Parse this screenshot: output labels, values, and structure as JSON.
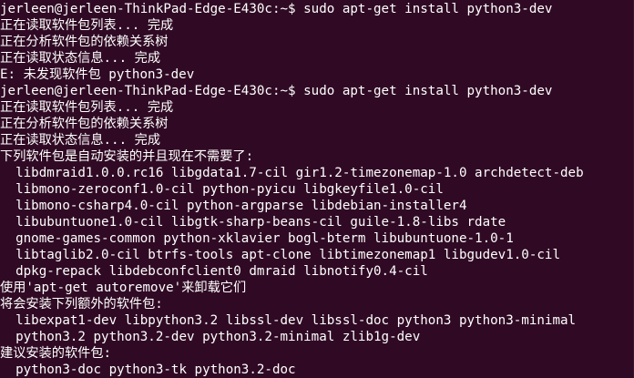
{
  "terminal": {
    "lines": [
      "jerleen@jerleen-ThinkPad-Edge-E430c:~$ sudo apt-get install python3-dev",
      "正在读取软件包列表... 完成",
      "正在分析软件包的依赖关系树",
      "正在读取状态信息... 完成",
      "E: 未发现软件包 python3-dev",
      "jerleen@jerleen-ThinkPad-Edge-E430c:~$ sudo apt-get install python3-dev",
      "正在读取软件包列表... 完成",
      "正在分析软件包的依赖关系树",
      "正在读取状态信息... 完成",
      "下列软件包是自动安装的并且现在不需要了:",
      "  libdmraid1.0.0.rc16 libgdata1.7-cil gir1.2-timezonemap-1.0 archdetect-deb",
      "  libmono-zeroconf1.0-cil python-pyicu libgkeyfile1.0-cil",
      "  libmono-csharp4.0-cil python-argparse libdebian-installer4",
      "  libubuntuone1.0-cil libgtk-sharp-beans-cil guile-1.8-libs rdate",
      "  gnome-games-common python-xklavier bogl-bterm libubuntuone-1.0-1",
      "  libtaglib2.0-cil btrfs-tools apt-clone libtimezonemap1 libgudev1.0-cil",
      "  dpkg-repack libdebconfclient0 dmraid libnotify0.4-cil",
      "使用'apt-get autoremove'来卸载它们",
      "将会安装下列额外的软件包:",
      "  libexpat1-dev libpython3.2 libssl-dev libssl-doc python3 python3-minimal",
      "  python3.2 python3.2-dev python3.2-minimal zlib1g-dev",
      "建议安装的软件包:",
      "  python3-doc python3-tk python3.2-doc"
    ]
  },
  "colors": {
    "background": "#300a24",
    "text": "#ffffff"
  }
}
